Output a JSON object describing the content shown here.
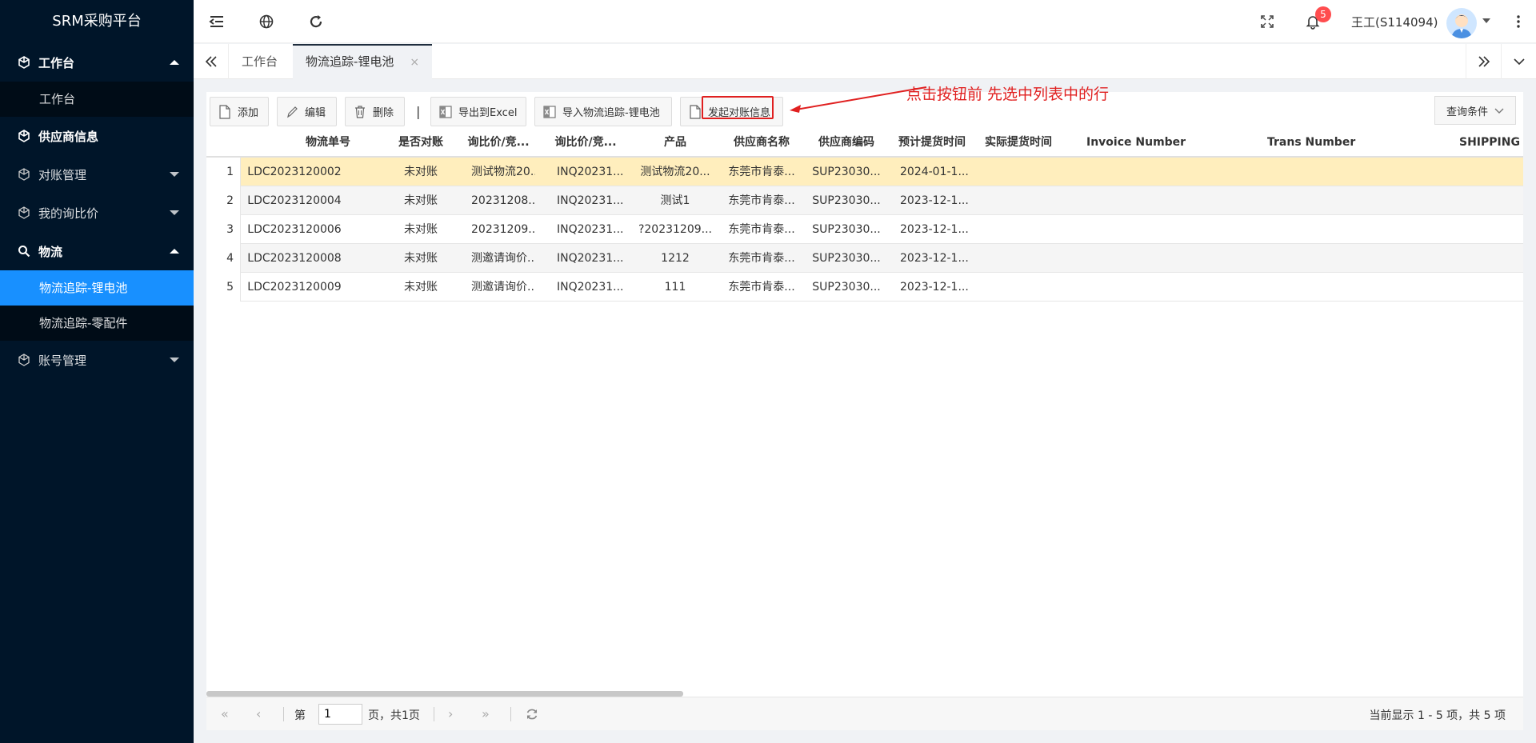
{
  "app": {
    "title": "SRM采购平台"
  },
  "sidebar": {
    "groups": [
      {
        "label": "工作台",
        "expanded": true,
        "items": [
          "工作台"
        ]
      },
      {
        "label": "供应商信息"
      },
      {
        "label": "对账管理",
        "expanded": false
      },
      {
        "label": "我的询比价",
        "expanded": false
      },
      {
        "label": "物流",
        "expanded": true,
        "items": [
          "物流追踪-锂电池",
          "物流追踪-零配件"
        ],
        "active": "物流追踪-锂电池"
      },
      {
        "label": "账号管理",
        "expanded": false
      }
    ]
  },
  "header": {
    "notification_count": "5",
    "user": "王工(S114094)"
  },
  "tabs": [
    {
      "label": "工作台"
    },
    {
      "label": "物流追踪-锂电池",
      "active": true
    }
  ],
  "toolbar": {
    "add": "添加",
    "edit": "编辑",
    "delete": "删除",
    "separator": "|",
    "export": "导出到Excel",
    "import": "导入物流追踪-锂电池",
    "reconcile": "发起对账信息",
    "query": "查询条件"
  },
  "annotation": "点击按钮前 先选中列表中的行",
  "grid": {
    "columns": [
      "物流单号",
      "是否对账",
      "询比价/竞...",
      "询比价/竞...",
      "产品",
      "供应商名称",
      "供应商编码",
      "预计提货时间",
      "实际提货时间",
      "Invoice Number",
      "Trans Number",
      "SHIPPING I"
    ],
    "rows": [
      {
        "num": "1",
        "cells": [
          "LDC2023120002",
          "未对账",
          "测试物流20...",
          "INQ20231...",
          "测试物流20...",
          "东莞市肯泰...",
          "SUP23030...",
          "2024-01-1...",
          "",
          "",
          ""
        ]
      },
      {
        "num": "2",
        "cells": [
          "LDC2023120004",
          "未对账",
          "20231208...",
          "INQ20231...",
          "测试1",
          "东莞市肯泰...",
          "SUP23030...",
          "2023-12-1...",
          "",
          "",
          ""
        ]
      },
      {
        "num": "3",
        "cells": [
          "LDC2023120006",
          "未对账",
          "20231209...",
          "INQ20231...",
          "?20231209...",
          "东莞市肯泰...",
          "SUP23030...",
          "2023-12-1...",
          "",
          "",
          ""
        ]
      },
      {
        "num": "4",
        "cells": [
          "LDC2023120008",
          "未对账",
          "测邀请询价...",
          "INQ20231...",
          "1212",
          "东莞市肯泰...",
          "SUP23030...",
          "2023-12-1...",
          "",
          "",
          ""
        ]
      },
      {
        "num": "5",
        "cells": [
          "LDC2023120009",
          "未对账",
          "测邀请询价...",
          "INQ20231...",
          "111",
          "东莞市肯泰...",
          "SUP23030...",
          "2023-12-1...",
          "",
          "",
          ""
        ]
      }
    ],
    "selected_row": 1
  },
  "pager": {
    "page_label": "第",
    "page_value": "1",
    "page_total": "页，共1页",
    "summary": "当前显示 1 - 5 项，共 5 项"
  },
  "colors": {
    "sidebar_bg": "#001529",
    "active": "#1890ff",
    "selected_row": "#ffeebd",
    "annotation": "#e02020"
  }
}
